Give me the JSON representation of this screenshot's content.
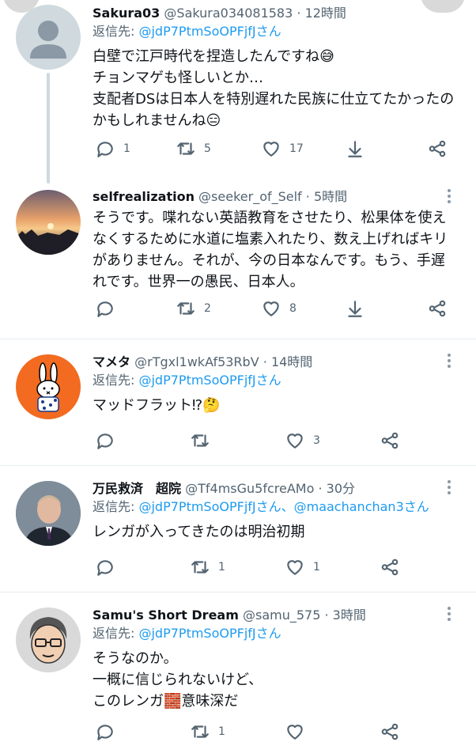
{
  "tweets": [
    {
      "name": "Sakura03",
      "handle": "@Sakura034081583",
      "time": "12時間",
      "reply_label": "返信先: ",
      "reply_mention": "@jdP7PtmSoOPFjfJさん",
      "lines": [
        "白壁で江戸時代を捏造したんですね😅",
        "チョンマゲも怪しいとか…",
        "支配者DSは日本人を特別遅れた民族に仕立てたかったの",
        "かもしれませんね😑"
      ],
      "replies": "1",
      "retweets": "5",
      "likes": "17"
    },
    {
      "name": "selfrealization",
      "handle": "@seeker_of_Self",
      "time": "5時間",
      "lines": [
        "そうです。喋れない英語教育をさせたり、松果体を使え",
        "なくするために水道に塩素入れたり、数え上げればキリ",
        "がありません。それが、今の日本なんです。もう、手遅",
        "れです。世界一の愚民、日本人。"
      ],
      "replies": "",
      "retweets": "2",
      "likes": "8"
    },
    {
      "name": "マメタ",
      "handle": "@rTgxl1wkAf53RbV",
      "time": "14時間",
      "reply_label": "返信先: ",
      "reply_mention": "@jdP7PtmSoOPFjfJさん",
      "lines": [
        "マッドフラット⁉🤔"
      ],
      "replies": "",
      "retweets": "",
      "likes": "3"
    },
    {
      "name": "万民救済　超院",
      "handle": "@Tf4msGu5fcreAMo",
      "time": "30分",
      "reply_label": "返信先: ",
      "reply_mention": "@jdP7PtmSoOPFjfJさん、@maachanchan3さん",
      "lines": [
        "レンガが入ってきたのは明治初期"
      ],
      "replies": "",
      "retweets": "1",
      "likes": "1"
    },
    {
      "name": "Samu's Short Dream",
      "handle": "@samu_575",
      "time": "3時間",
      "reply_label": "返信先: ",
      "reply_mention": "@jdP7PtmSoOPFjfJさん",
      "lines": [
        "そうなのか。",
        "一概に信じられないけど、",
        "このレンガ🧱意味深だ"
      ],
      "replies": "",
      "retweets": "1",
      "likes": ""
    }
  ],
  "ui": {
    "separator": "·"
  }
}
